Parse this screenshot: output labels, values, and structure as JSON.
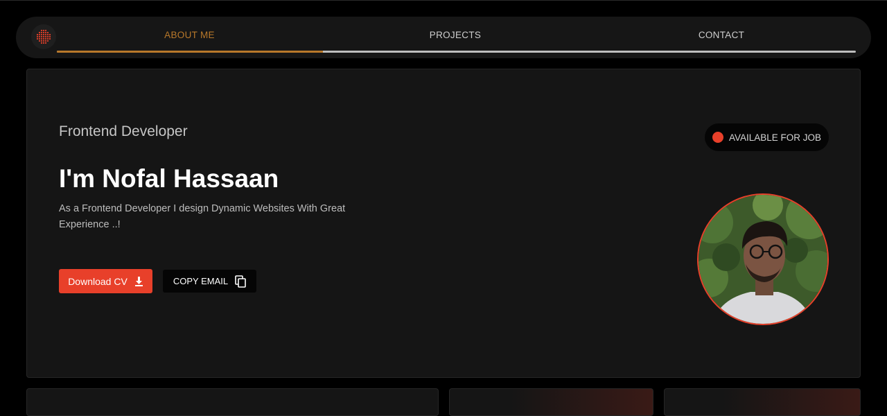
{
  "nav": {
    "logo_icon": "dotted-sphere-icon",
    "tabs": [
      {
        "label": "ABOUT ME",
        "active": true
      },
      {
        "label": "PROJECTS",
        "active": false
      },
      {
        "label": "CONTACT",
        "active": false
      }
    ],
    "scroll_progress": 0.333
  },
  "hero": {
    "role": "Frontend Developer",
    "name": "I'm Nofal Hassaan",
    "description": "As a Frontend Developer I design Dynamic Websites With Great Experience ..!",
    "download_button": {
      "label": "Download CV",
      "icon": "download-icon"
    },
    "copy_email_button": {
      "label": "COPY EMAIL",
      "icon": "copy-icon"
    },
    "status_badge": {
      "label": "AVAILABLE FOR JOB",
      "indicator_color": "#e8402a"
    },
    "avatar_alt": "profile-photo"
  },
  "colors": {
    "accent": "#e8402a",
    "nav_active": "#b8782a",
    "card_bg": "#151515",
    "page_bg": "#000000"
  }
}
